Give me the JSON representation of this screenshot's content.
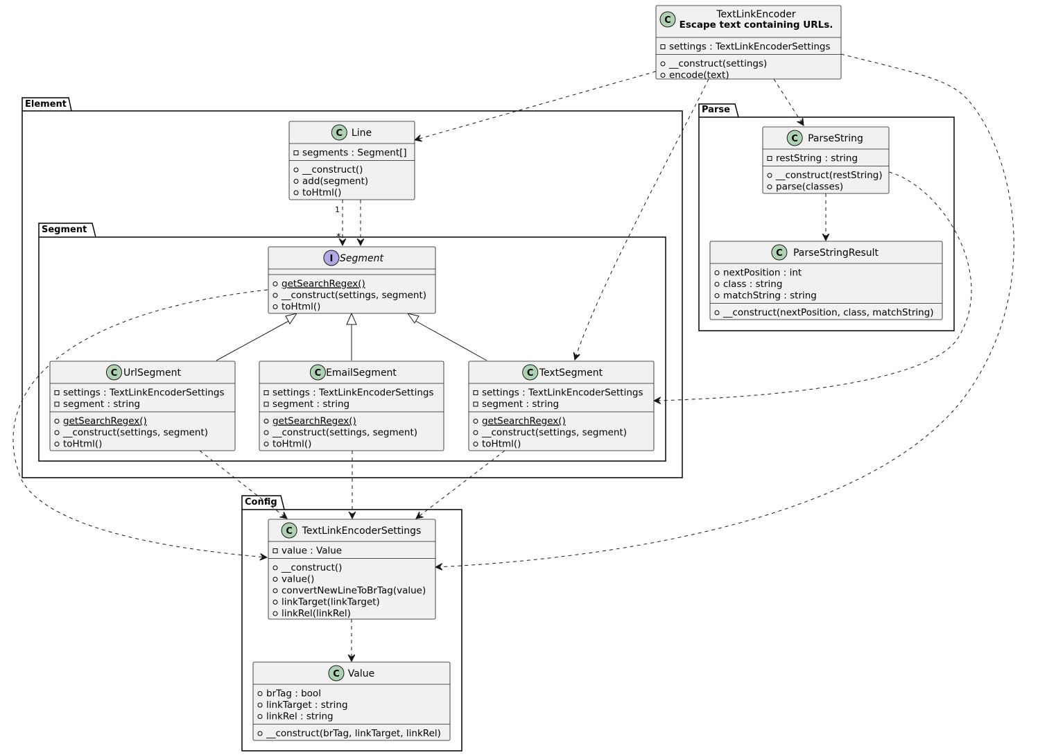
{
  "packages": {
    "element": "Element",
    "segment": "Segment",
    "parse": "Parse",
    "config": "Config"
  },
  "classes": {
    "textLinkEncoder": {
      "stereotype": "C",
      "name": "TextLinkEncoder",
      "subtitle": "Escape text containing URLs.",
      "fields": [
        {
          "vis": "-",
          "text": "settings : TextLinkEncoderSettings"
        }
      ],
      "methods": [
        {
          "vis": "+",
          "text": "__construct(settings)"
        },
        {
          "vis": "+",
          "text": "encode(text)"
        }
      ]
    },
    "line": {
      "stereotype": "C",
      "name": "Line",
      "fields": [
        {
          "vis": "-",
          "text": "segments : Segment[]"
        }
      ],
      "methods": [
        {
          "vis": "+",
          "text": "__construct()"
        },
        {
          "vis": "+",
          "text": "add(segment)"
        },
        {
          "vis": "+",
          "text": "toHtml()"
        }
      ]
    },
    "segment": {
      "stereotype": "I",
      "name": "Segment",
      "fields": [],
      "methods": [
        {
          "vis": "+",
          "text": "getSearchRegex()",
          "static": true
        },
        {
          "vis": "+",
          "text": "__construct(settings, segment)"
        },
        {
          "vis": "+",
          "text": "toHtml()"
        }
      ]
    },
    "urlSegment": {
      "stereotype": "C",
      "name": "UrlSegment",
      "fields": [
        {
          "vis": "-",
          "text": "settings : TextLinkEncoderSettings"
        },
        {
          "vis": "-",
          "text": "segment : string"
        }
      ],
      "methods": [
        {
          "vis": "+",
          "text": "getSearchRegex()",
          "static": true
        },
        {
          "vis": "+",
          "text": "__construct(settings, segment)"
        },
        {
          "vis": "+",
          "text": "toHtml()"
        }
      ]
    },
    "emailSegment": {
      "stereotype": "C",
      "name": "EmailSegment",
      "fields": [
        {
          "vis": "-",
          "text": "settings : TextLinkEncoderSettings"
        },
        {
          "vis": "-",
          "text": "segment : string"
        }
      ],
      "methods": [
        {
          "vis": "+",
          "text": "getSearchRegex()",
          "static": true
        },
        {
          "vis": "+",
          "text": "__construct(settings, segment)"
        },
        {
          "vis": "+",
          "text": "toHtml()"
        }
      ]
    },
    "textSegment": {
      "stereotype": "C",
      "name": "TextSegment",
      "fields": [
        {
          "vis": "-",
          "text": "settings : TextLinkEncoderSettings"
        },
        {
          "vis": "-",
          "text": "segment : string"
        }
      ],
      "methods": [
        {
          "vis": "+",
          "text": "getSearchRegex()",
          "static": true
        },
        {
          "vis": "+",
          "text": "__construct(settings, segment)"
        },
        {
          "vis": "+",
          "text": "toHtml()"
        }
      ]
    },
    "parseString": {
      "stereotype": "C",
      "name": "ParseString",
      "fields": [
        {
          "vis": "-",
          "text": "restString : string"
        }
      ],
      "methods": [
        {
          "vis": "+",
          "text": "__construct(restString)"
        },
        {
          "vis": "+",
          "text": "parse(classes)"
        }
      ]
    },
    "parseStringResult": {
      "stereotype": "C",
      "name": "ParseStringResult",
      "fields": [
        {
          "vis": "+",
          "text": "nextPosition : int"
        },
        {
          "vis": "+",
          "text": "class : string"
        },
        {
          "vis": "+",
          "text": "matchString : string"
        }
      ],
      "methods": [
        {
          "vis": "+",
          "text": "__construct(nextPosition, class, matchString)"
        }
      ]
    },
    "textLinkEncoderSettings": {
      "stereotype": "C",
      "name": "TextLinkEncoderSettings",
      "fields": [
        {
          "vis": "-",
          "text": "value : Value"
        }
      ],
      "methods": [
        {
          "vis": "+",
          "text": "__construct()"
        },
        {
          "vis": "+",
          "text": "value()"
        },
        {
          "vis": "+",
          "text": "convertNewLineToBrTag(value)"
        },
        {
          "vis": "+",
          "text": "linkTarget(linkTarget)"
        },
        {
          "vis": "+",
          "text": "linkRel(linkRel)"
        }
      ]
    },
    "value": {
      "stereotype": "C",
      "name": "Value",
      "fields": [
        {
          "vis": "+",
          "text": "brTag : bool"
        },
        {
          "vis": "+",
          "text": "linkTarget : string"
        },
        {
          "vis": "+",
          "text": "linkRel : string"
        }
      ],
      "methods": [
        {
          "vis": "+",
          "text": "__construct(brTag, linkTarget, linkRel)"
        }
      ]
    }
  },
  "relations": [
    {
      "from": "textLinkEncoder",
      "to": "line",
      "type": "dependency"
    },
    {
      "from": "textLinkEncoder",
      "to": "textSegment",
      "type": "dependency"
    },
    {
      "from": "textLinkEncoder",
      "to": "parseString",
      "type": "dependency"
    },
    {
      "from": "textLinkEncoder",
      "to": "textLinkEncoderSettings",
      "type": "dependency"
    },
    {
      "from": "line",
      "to": "segment",
      "type": "dependency",
      "fromLabel": "1",
      "toLabel": "*"
    },
    {
      "from": "line",
      "to": "segment",
      "type": "dependency"
    },
    {
      "from": "urlSegment",
      "to": "segment",
      "type": "realization"
    },
    {
      "from": "emailSegment",
      "to": "segment",
      "type": "realization"
    },
    {
      "from": "textSegment",
      "to": "segment",
      "type": "realization"
    },
    {
      "from": "segment",
      "to": "textLinkEncoderSettings",
      "type": "dependency"
    },
    {
      "from": "urlSegment",
      "to": "textLinkEncoderSettings",
      "type": "dependency"
    },
    {
      "from": "emailSegment",
      "to": "textLinkEncoderSettings",
      "type": "dependency"
    },
    {
      "from": "textSegment",
      "to": "textLinkEncoderSettings",
      "type": "dependency"
    },
    {
      "from": "parseString",
      "to": "parseStringResult",
      "type": "dependency"
    },
    {
      "from": "parseString",
      "to": "textSegment",
      "type": "dependency"
    },
    {
      "from": "textLinkEncoderSettings",
      "to": "value",
      "type": "dependency"
    }
  ],
  "colors": {
    "classFill": "#f1f1f1",
    "classBorder": "#181818",
    "classCircle": "#add1b2",
    "interfaceCircle": "#b4a7e5",
    "packageBorder": "#000000",
    "edge": "#181818"
  }
}
